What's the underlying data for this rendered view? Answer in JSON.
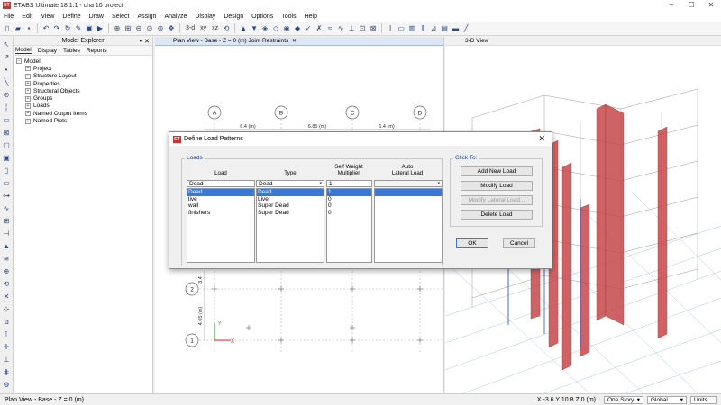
{
  "app": {
    "title": "ETABS Ultimate 18.1.1 - cha 10 project",
    "logo": "ET",
    "window_controls": [
      "–",
      "☐",
      "✕"
    ]
  },
  "menu": [
    "File",
    "Edit",
    "View",
    "Define",
    "Draw",
    "Select",
    "Assign",
    "Analyze",
    "Display",
    "Design",
    "Options",
    "Tools",
    "Help"
  ],
  "toolbar": {
    "view_3d_label": "3-d",
    "plan_label": "xy",
    "elev_label": "xz"
  },
  "explorer": {
    "title": "Model Explorer",
    "buttons": "▾ ✕",
    "tabs": [
      "Model",
      "Display",
      "Tables",
      "Reports"
    ],
    "tree_root": "Model",
    "tree_children": [
      "Project",
      "Structure Layout",
      "Properties",
      "Structural Objects",
      "Groups",
      "Loads",
      "Named Output Items",
      "Named Plots"
    ]
  },
  "plan_view": {
    "tab_label": "Plan View - Base - Z = 0 (m)  Joint Restraints",
    "close": "✕",
    "grid_cols": [
      "A",
      "B",
      "C",
      "D"
    ],
    "spacings": [
      "6.4 (m)",
      "6.85 (m)",
      "6.4 (m)"
    ],
    "grid_rows": [
      "2",
      "1"
    ],
    "row_spacing": "4.65 (m)",
    "row_spacing_partial": "3.4",
    "axis_x": "X",
    "axis_y": "Y"
  },
  "view_3d": {
    "tab_label": "3-D View",
    "close": "✕"
  },
  "dialog": {
    "title": "Define Load Patterns",
    "close": "✕",
    "loads_group": "Loads",
    "click_group": "Click To:",
    "col_load": "Load",
    "col_type": "Type",
    "col_multiplier_1": "Self Weight",
    "col_multiplier_2": "Multiplier",
    "col_auto_1": "Auto",
    "col_auto_2": "Lateral Load",
    "entry_load": "Dead",
    "entry_type": "Dead",
    "entry_multiplier": "1",
    "entry_auto": "",
    "rows": [
      {
        "load": "Dead",
        "type": "Dead",
        "multiplier": "1",
        "auto": ""
      },
      {
        "load": "live",
        "type": "Live",
        "multiplier": "0",
        "auto": ""
      },
      {
        "load": "wall",
        "type": "Super Dead",
        "multiplier": "0",
        "auto": ""
      },
      {
        "load": "finishers",
        "type": "Super Dead",
        "multiplier": "0",
        "auto": ""
      }
    ],
    "buttons": {
      "add": "Add New Load",
      "modify": "Modify Load",
      "modify_lateral": "Modify Lateral Load...",
      "delete": "Delete Load",
      "ok": "OK",
      "cancel": "Cancel"
    }
  },
  "status": {
    "left": "Plan View - Base - Z = 0 (m)",
    "coords": "X -3.6  Y 10.8  Z 0 (m)",
    "story": "One Story",
    "coord_system": "Global",
    "units": "Units..."
  }
}
